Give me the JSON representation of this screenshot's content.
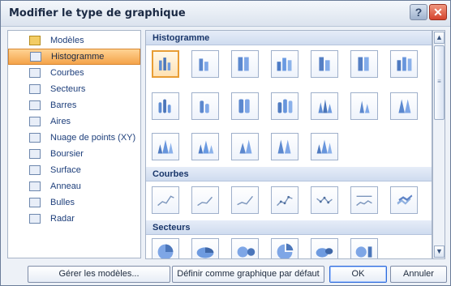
{
  "window": {
    "title": "Modifier le type de graphique",
    "help_label": "?",
    "close_label": "✕"
  },
  "sidebar": {
    "items": [
      {
        "label": "Modèles",
        "icon": "folder-icon"
      },
      {
        "label": "Histogramme",
        "icon": "column-chart-icon",
        "selected": true
      },
      {
        "label": "Courbes",
        "icon": "line-chart-icon"
      },
      {
        "label": "Secteurs",
        "icon": "pie-chart-icon"
      },
      {
        "label": "Barres",
        "icon": "bar-chart-icon"
      },
      {
        "label": "Aires",
        "icon": "area-chart-icon"
      },
      {
        "label": "Nuage de points (XY)",
        "icon": "scatter-chart-icon"
      },
      {
        "label": "Boursier",
        "icon": "stock-chart-icon"
      },
      {
        "label": "Surface",
        "icon": "surface-chart-icon"
      },
      {
        "label": "Anneau",
        "icon": "doughnut-chart-icon"
      },
      {
        "label": "Bulles",
        "icon": "bubble-chart-icon"
      },
      {
        "label": "Radar",
        "icon": "radar-chart-icon"
      }
    ]
  },
  "gallery": {
    "sections": [
      {
        "title": "Histogramme"
      },
      {
        "title": "Courbes"
      },
      {
        "title": "Secteurs"
      }
    ]
  },
  "buttons": {
    "manage": "Gérer les modèles...",
    "default": "Définir comme graphique par défaut",
    "ok": "OK",
    "cancel": "Annuler"
  },
  "scrollbar": {
    "up": "▲",
    "down": "▼",
    "grip": "≡"
  }
}
